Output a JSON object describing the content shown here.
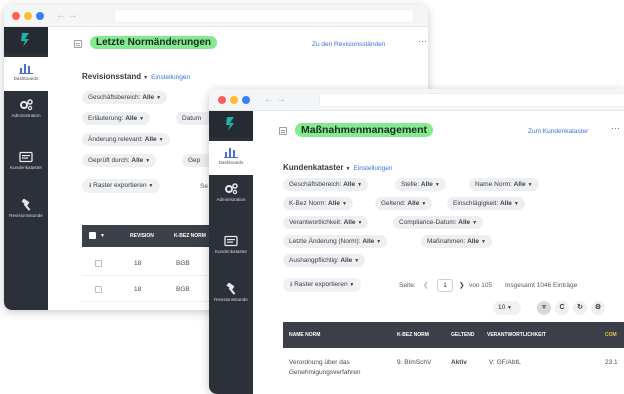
{
  "window_back": {
    "title": "Letzte Normänderungen",
    "top_link": "Zu den Revisionsständen",
    "section_title": "Revisionsstand",
    "section_link": "Einstellungen",
    "sidebar": [
      {
        "label": "Dashboards"
      },
      {
        "label": "Administration"
      },
      {
        "label": "Kundenkataster"
      },
      {
        "label": "Revisionsstunde"
      }
    ],
    "filters": [
      {
        "label": "Geschäftsbereich:",
        "value": "Alle"
      },
      {
        "label": "Erläuterung:",
        "value": "Alle"
      },
      {
        "label": "Datum",
        "value": ""
      },
      {
        "label": "Änderung relevant:",
        "value": "Alle"
      },
      {
        "label": "Geprüft durch:",
        "value": "Alle"
      },
      {
        "label": "Gep",
        "value": ""
      }
    ],
    "export_label": "Raster exportieren",
    "export_suffix": "Se",
    "columns": [
      "REVISION",
      "K-BEZ NORM"
    ],
    "rows": [
      {
        "revision": "18",
        "kbez": "BGB"
      },
      {
        "revision": "18",
        "kbez": "BGB"
      }
    ]
  },
  "window_front": {
    "title": "Maßnahmenmanagement",
    "top_link": "Zum Kundenkataster",
    "section_title": "Kundenkataster",
    "section_link": "Einstellungen",
    "sidebar": [
      {
        "label": "Dashboards"
      },
      {
        "label": "Administration"
      },
      {
        "label": "Kundenkataster"
      },
      {
        "label": "Revisionsstunde"
      }
    ],
    "filters": [
      {
        "label": "Geschäftsbereich:",
        "value": "Alle"
      },
      {
        "label": "Stelle:",
        "value": "Alle"
      },
      {
        "label": "Name Norm:",
        "value": "Alle"
      },
      {
        "label": "K-Bez Norm:",
        "value": "Alle"
      },
      {
        "label": "Geltend:",
        "value": "Alle"
      },
      {
        "label": "Einschlägigkeit:",
        "value": "Alle"
      },
      {
        "label": "Verantwortlichkeit:",
        "value": "Alle"
      },
      {
        "label": "Compliance-Datum:",
        "value": "Alle"
      },
      {
        "label": "Letzte Änderung (Norm):",
        "value": "Alle"
      },
      {
        "label": "Maßnahmen:",
        "value": "Alle"
      },
      {
        "label": "Aushangpflichtig:",
        "value": "Alle"
      }
    ],
    "export_label": "Raster exportieren",
    "pager": {
      "page_label": "Seite:",
      "current_page": "1",
      "total_text": "von 105",
      "entries_text": "Insgesamt 1046 Einträge",
      "page_size": "10"
    },
    "columns": [
      "NAME NORM",
      "K-BEZ NORM",
      "GELTEND",
      "VERANTWORTLICHKEIT",
      "COM"
    ],
    "rows": [
      {
        "name_norm": "Verordnung über das",
        "name_norm_2": "Genehmigungsverfahren",
        "kbez": "9. BImSchV",
        "geltend": "Aktiv",
        "verantwortlichkeit": "V: GF/AbtL",
        "compliance": "23.1"
      }
    ]
  },
  "colors": {
    "sidebar": "#2c3038",
    "title_pill": "#84ea8f",
    "link": "#3c6fe6",
    "logo": "#1fb3a6",
    "table_header": "#3a3f48"
  }
}
